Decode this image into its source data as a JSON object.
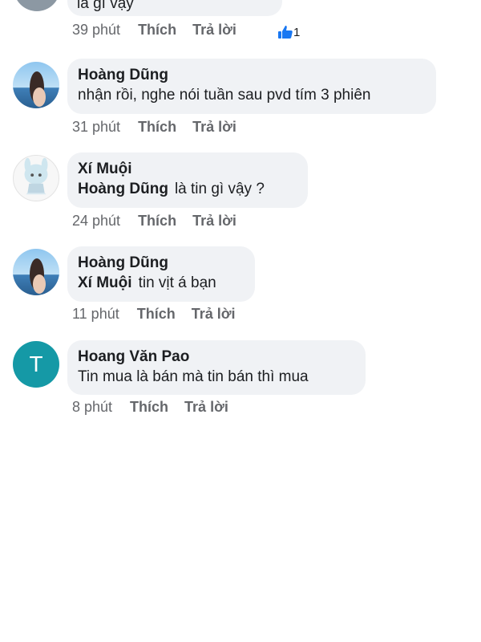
{
  "comments": [
    {
      "text": "là gì vậy",
      "time": "39 phút",
      "like_label": "Thích",
      "reply_label": "Trả lời",
      "reaction_count": "1"
    },
    {
      "author": "Hoàng Dũng",
      "text": "nhận rồi, nghe nói tuần sau pvd tím 3 phiên",
      "time": "31 phút",
      "like_label": "Thích",
      "reply_label": "Trả lời"
    },
    {
      "author": "Xí Muội",
      "mention": "Hoàng Dũng",
      "text": "là tin gì vậy ?",
      "time": "24 phút",
      "like_label": "Thích",
      "reply_label": "Trả lời"
    },
    {
      "author": "Hoàng Dũng",
      "mention": "Xí Muội",
      "text": "tin vịt á bạn",
      "time": "11 phút",
      "like_label": "Thích",
      "reply_label": "Trả lời"
    },
    {
      "author": "Hoang Văn Pao",
      "avatar_letter": "T",
      "text": "Tin mua là bán mà tin bán thì mua",
      "time": "8 phút",
      "like_label": "Thích",
      "reply_label": "Trả lời"
    }
  ],
  "colors": {
    "bubble": "#f0f2f5",
    "meta_text": "#65676b",
    "like_blue": "#1877f2",
    "letter_avatar": "#1599a6"
  }
}
